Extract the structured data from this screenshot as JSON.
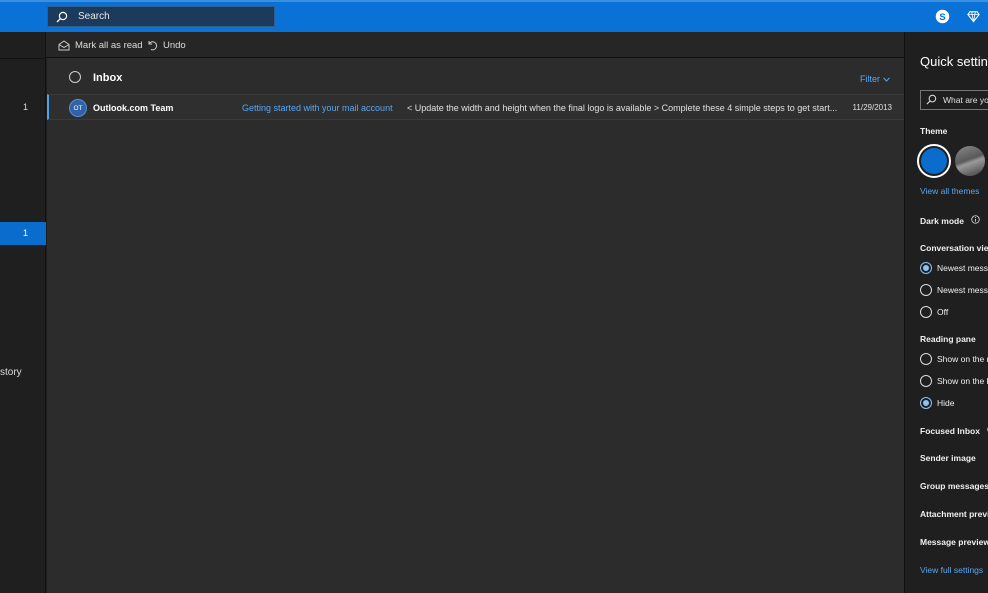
{
  "topbar": {
    "search_placeholder": "Search",
    "icons": [
      "skype-icon",
      "premium-diamond-icon"
    ]
  },
  "leftrail": {
    "counts": [
      "1",
      "1"
    ],
    "partial_text": "story"
  },
  "commandbar": {
    "mark_all_read": "Mark all as read",
    "undo": "Undo"
  },
  "maillist": {
    "title": "Inbox",
    "filter": "Filter",
    "messages": [
      {
        "avatar": "OT",
        "sender": "Outlook.com Team",
        "subject": "Getting started with your mail account",
        "preview": "< Update the width and height when the final logo is available > Complete these 4 simple steps to get start...",
        "date": "11/29/2013"
      }
    ]
  },
  "quick_settings": {
    "title": "Quick settings",
    "search_placeholder": "What are you looking for?",
    "theme_label": "Theme",
    "view_all_themes": "View all themes",
    "dark_mode": "Dark mode",
    "conversation_view": "Conversation view",
    "conv_options": [
      "Newest messages on top",
      "Newest messages on bottom",
      "Off"
    ],
    "reading_pane": "Reading pane",
    "reading_options": [
      "Show on the right",
      "Show on the bottom",
      "Hide"
    ],
    "focused_inbox": "Focused Inbox",
    "sender_image": "Sender image",
    "group_messages": "Group messages",
    "attachment_preview": "Attachment preview",
    "message_preview": "Message preview",
    "view_full_settings": "View full settings"
  },
  "colors": {
    "accent": "#0a72d6",
    "link": "#5aa6f0",
    "list_bg": "#2c2c2c",
    "panel_bg": "#1f1f1f"
  }
}
